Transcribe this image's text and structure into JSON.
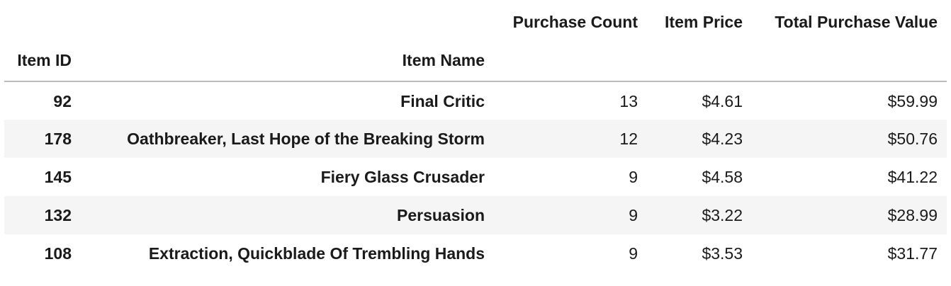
{
  "table": {
    "columns": {
      "item_id": "Item ID",
      "item_name": "Item Name",
      "purchase_count": "Purchase Count",
      "item_price": "Item Price",
      "total_purchase_value": "Total Purchase Value"
    },
    "rows": [
      {
        "id": "92",
        "name": "Final Critic",
        "count": "13",
        "price": "$4.61",
        "total": "$59.99"
      },
      {
        "id": "178",
        "name": "Oathbreaker, Last Hope of the Breaking Storm",
        "count": "12",
        "price": "$4.23",
        "total": "$50.76"
      },
      {
        "id": "145",
        "name": "Fiery Glass Crusader",
        "count": "9",
        "price": "$4.58",
        "total": "$41.22"
      },
      {
        "id": "132",
        "name": "Persuasion",
        "count": "9",
        "price": "$3.22",
        "total": "$28.99"
      },
      {
        "id": "108",
        "name": "Extraction, Quickblade Of Trembling Hands",
        "count": "9",
        "price": "$3.53",
        "total": "$31.77"
      }
    ]
  }
}
